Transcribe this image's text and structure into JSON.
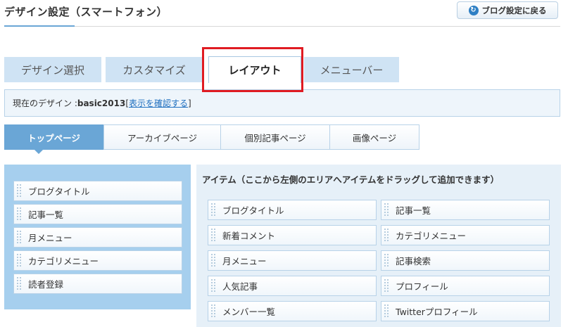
{
  "header": {
    "title": "デザイン設定（スマートフォン）",
    "back_button": "ブログ設定に戻る"
  },
  "tabs": [
    {
      "label": "デザイン選択"
    },
    {
      "label": "カスタマイズ"
    },
    {
      "label": "レイアウト"
    },
    {
      "label": "メニューバー"
    }
  ],
  "info": {
    "prefix": "現在のデザイン : ",
    "design_name": "basic2013",
    "bracket_open": "[",
    "link": "表示を確認する",
    "bracket_close": "]"
  },
  "subtabs": [
    {
      "label": "トップページ"
    },
    {
      "label": "アーカイブページ"
    },
    {
      "label": "個別記事ページ"
    },
    {
      "label": "画像ページ"
    }
  ],
  "layout_items": [
    {
      "label": "ブログタイトル"
    },
    {
      "label": "記事一覧"
    },
    {
      "label": "月メニュー"
    },
    {
      "label": "カテゴリメニュー"
    },
    {
      "label": "読者登録"
    }
  ],
  "available": {
    "title": "アイテム（ここから左側のエリアへアイテムをドラッグして追加できます）",
    "items": [
      {
        "label": "ブログタイトル"
      },
      {
        "label": "記事一覧"
      },
      {
        "label": "新着コメント"
      },
      {
        "label": "カテゴリメニュー"
      },
      {
        "label": "月メニュー"
      },
      {
        "label": "記事検索"
      },
      {
        "label": "人気記事"
      },
      {
        "label": "プロフィール"
      },
      {
        "label": "メンバー一覧"
      },
      {
        "label": "Twitterプロフィール"
      }
    ]
  },
  "colors": {
    "accent": "#6aa6d6",
    "highlight_box": "#e01b22",
    "left_panel": "#a6cfee",
    "tab_inactive": "#cfe3f4"
  },
  "icons": {
    "back": "back-arrow-icon",
    "grip": "drag-handle-icon"
  }
}
